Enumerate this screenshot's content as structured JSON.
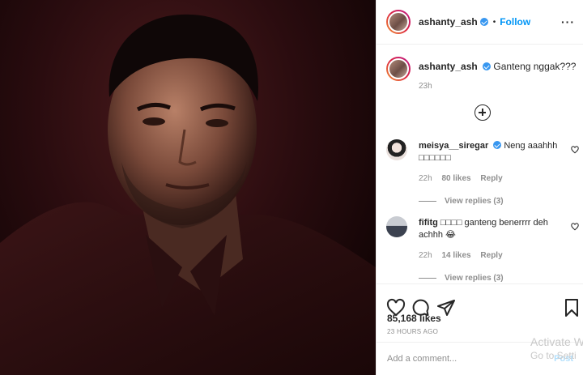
{
  "post": {
    "username": "ashanty_ash",
    "follow_label": "Follow",
    "separator": "•",
    "more_label": "···",
    "caption_text": "Ganteng nggak???",
    "caption_time": "23h",
    "likes": "85,168 likes",
    "posted_ago": "23 HOURS AGO",
    "add_comment_placeholder": "Add a comment...",
    "post_label": "Post"
  },
  "comments": [
    {
      "username": "meisya__siregar",
      "text": "Neng aaahhh",
      "text_line2": "□□□□□□",
      "time": "22h",
      "likes": "80 likes",
      "reply": "Reply",
      "view_replies": "View replies (3)"
    },
    {
      "username": "fifitg",
      "text": "□□□□ ganteng benerrrr deh",
      "text_line2": "achhh 😂",
      "time": "22h",
      "likes": "14 likes",
      "reply": "Reply",
      "view_replies": "View replies (3)"
    }
  ],
  "icons": {
    "like": "heart-icon",
    "comment": "comment-icon",
    "share": "share-icon",
    "save": "bookmark-icon",
    "add_more": "plus-circle-icon",
    "comment_like": "heart-icon",
    "verified": "verified-badge-icon"
  },
  "colors": {
    "link_blue": "#0095f6",
    "verified_blue": "#3897f0",
    "muted": "#8e8e8e",
    "photo_bg": "#2a0c0f"
  },
  "watermark": {
    "line1": "Activate W",
    "line2": "Go to Setti"
  }
}
